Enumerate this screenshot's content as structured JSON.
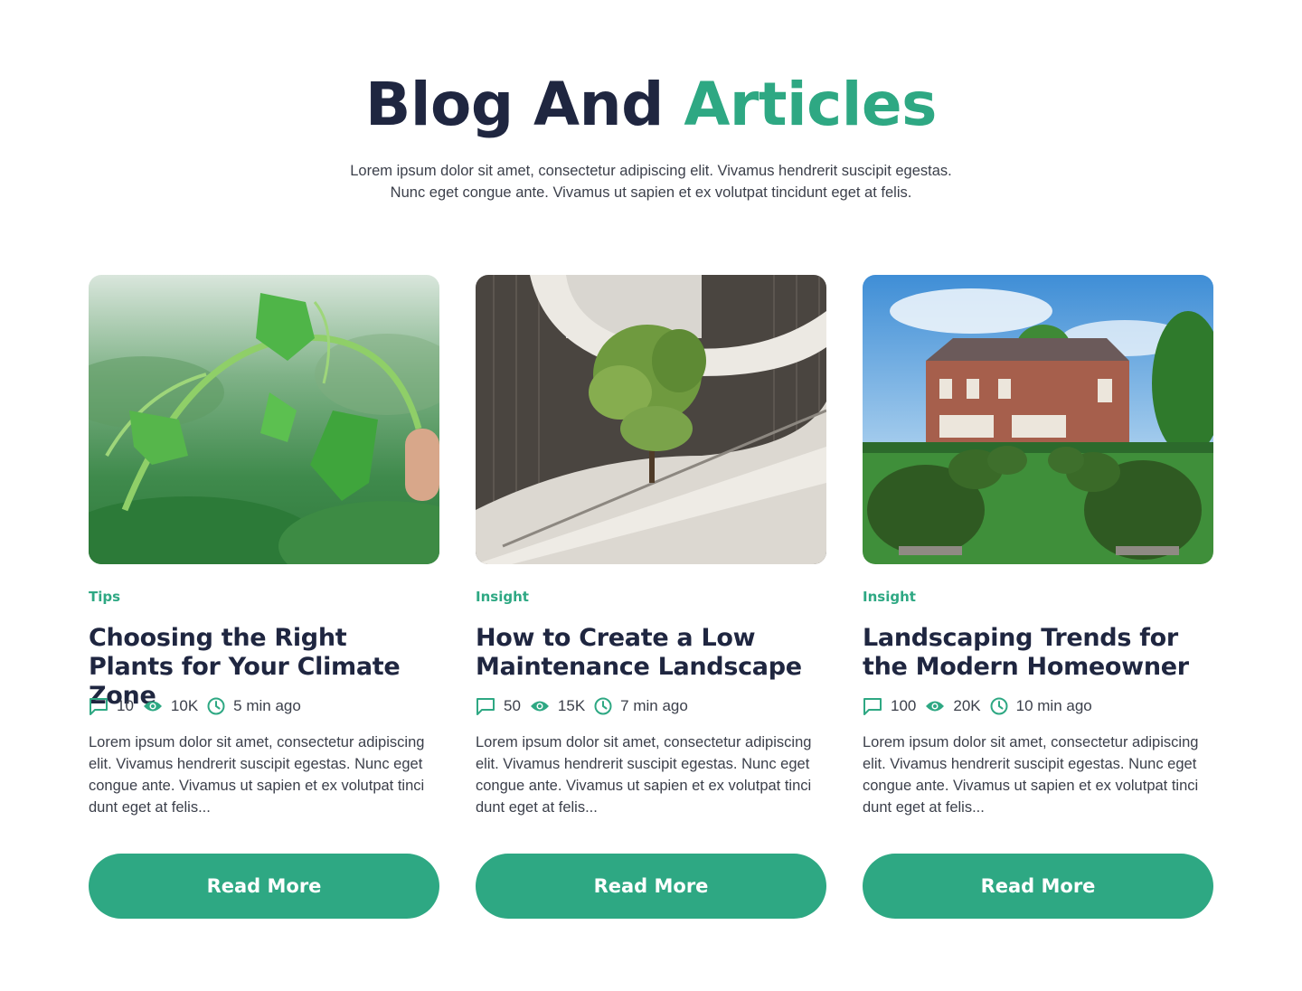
{
  "header": {
    "title_main": "Blog And",
    "title_accent": "Articles",
    "subtitle_line1": "Lorem ipsum dolor sit amet, consectetur adipiscing elit. Vivamus hendrerit suscipit egestas.",
    "subtitle_line2": "Nunc eget congue ante. Vivamus ut sapien et ex volutpat tincidunt eget at felis."
  },
  "colors": {
    "accent": "#2ea883",
    "heading": "#1f2640",
    "body_text": "#3b3f4a"
  },
  "icons": [
    "comment-icon",
    "eye-icon",
    "clock-icon"
  ],
  "cards": [
    {
      "image_subject": "climbing plant vine with green leaves",
      "tag": "Tips",
      "title": "Choosing the Right Plants for Your Climate Zone",
      "comments": "10",
      "views": "10K",
      "time": "5 min ago",
      "excerpt": "Lorem ipsum dolor sit amet, consectetur adipiscing elit. Vivamus hendrerit suscipit egestas. Nunc eget congue ante. Vivamus ut sapien et ex volutpat tincidunt eget at felis...",
      "button": "Read More"
    },
    {
      "image_subject": "tree in spiral concrete staircase",
      "tag": "Insight",
      "title": "How to Create a Low Maintenance Landscape",
      "comments": "50",
      "views": "15K",
      "time": "7 min ago",
      "excerpt": "Lorem ipsum dolor sit amet, consectetur adipiscing elit. Vivamus hendrerit suscipit egestas. Nunc eget congue ante. Vivamus ut sapien et ex volutpat tincidunt eget at felis...",
      "button": "Read More"
    },
    {
      "image_subject": "brick house with topiary garden",
      "tag": "Insight",
      "title": "Landscaping Trends for the Modern Homeowner",
      "comments": "100",
      "views": "20K",
      "time": "10 min ago",
      "excerpt": "Lorem ipsum dolor sit amet, consectetur adipiscing elit. Vivamus hendrerit suscipit egestas. Nunc eget congue ante. Vivamus ut sapien et ex volutpat tincidunt eget at felis...",
      "button": "Read More"
    }
  ]
}
